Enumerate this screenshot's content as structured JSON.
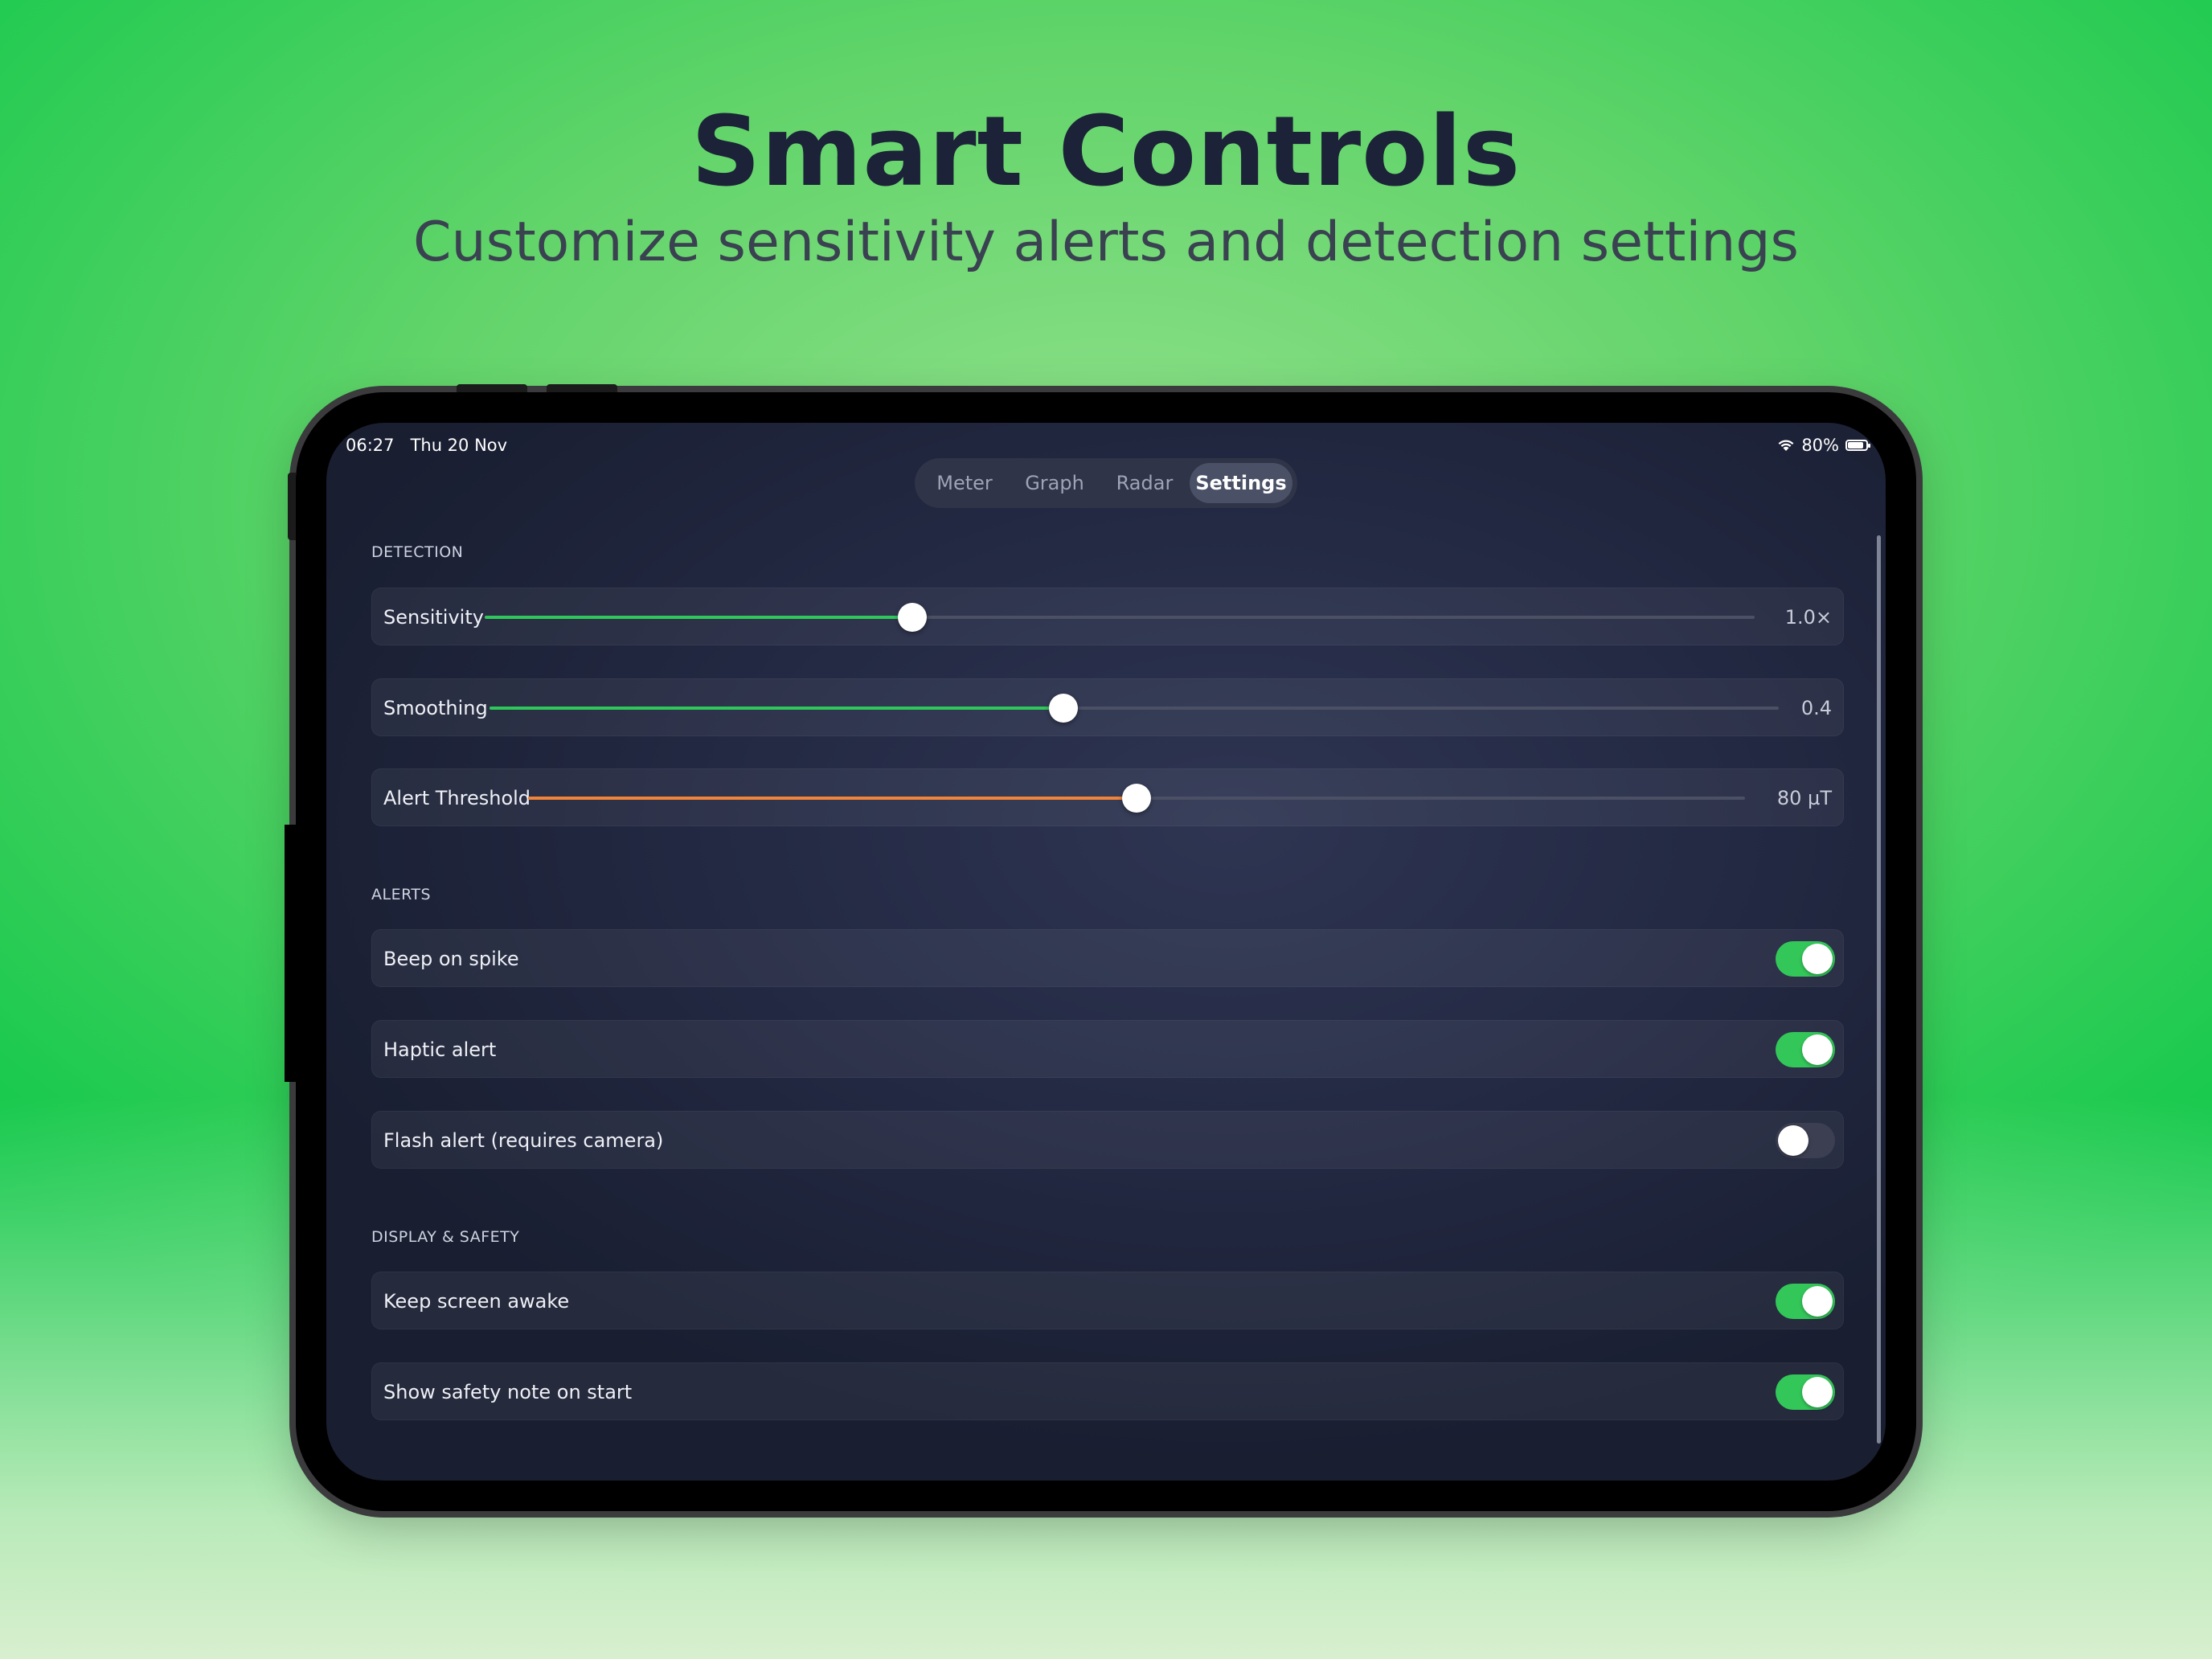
{
  "headline": "Smart Controls",
  "subheadline": "Customize sensitivity alerts and detection settings",
  "status_bar": {
    "time": "06:27",
    "date": "Thu 20 Nov",
    "battery": "80%"
  },
  "tabs": [
    {
      "label": "Meter",
      "active": false
    },
    {
      "label": "Graph",
      "active": false
    },
    {
      "label": "Radar",
      "active": false
    },
    {
      "label": "Settings",
      "active": true
    }
  ],
  "sections": {
    "detection": "DETECTION",
    "alerts": "ALERTS",
    "display": "DISPLAY & SAFETY"
  },
  "sliders": [
    {
      "label": "Sensitivity",
      "value_text": "1.0×",
      "fraction": 0.337,
      "color": "#30c75a"
    },
    {
      "label": "Smoothing",
      "value_text": "0.4",
      "fraction": 0.445,
      "color": "#30c75a"
    },
    {
      "label": "Alert Threshold",
      "value_text": "80 µT",
      "fraction": 0.5,
      "color": "#f0843a"
    }
  ],
  "toggles": [
    {
      "label": "Beep on spike",
      "on": true
    },
    {
      "label": "Haptic alert",
      "on": true
    },
    {
      "label": "Flash alert (requires camera)",
      "on": false
    },
    {
      "label": "Keep screen awake",
      "on": true
    },
    {
      "label": "Show safety note on start",
      "on": true
    }
  ],
  "colors": {
    "accent_green": "#33c759",
    "accent_orange": "#f0843a"
  },
  "icons": [
    "wifi-icon",
    "battery-icon"
  ]
}
